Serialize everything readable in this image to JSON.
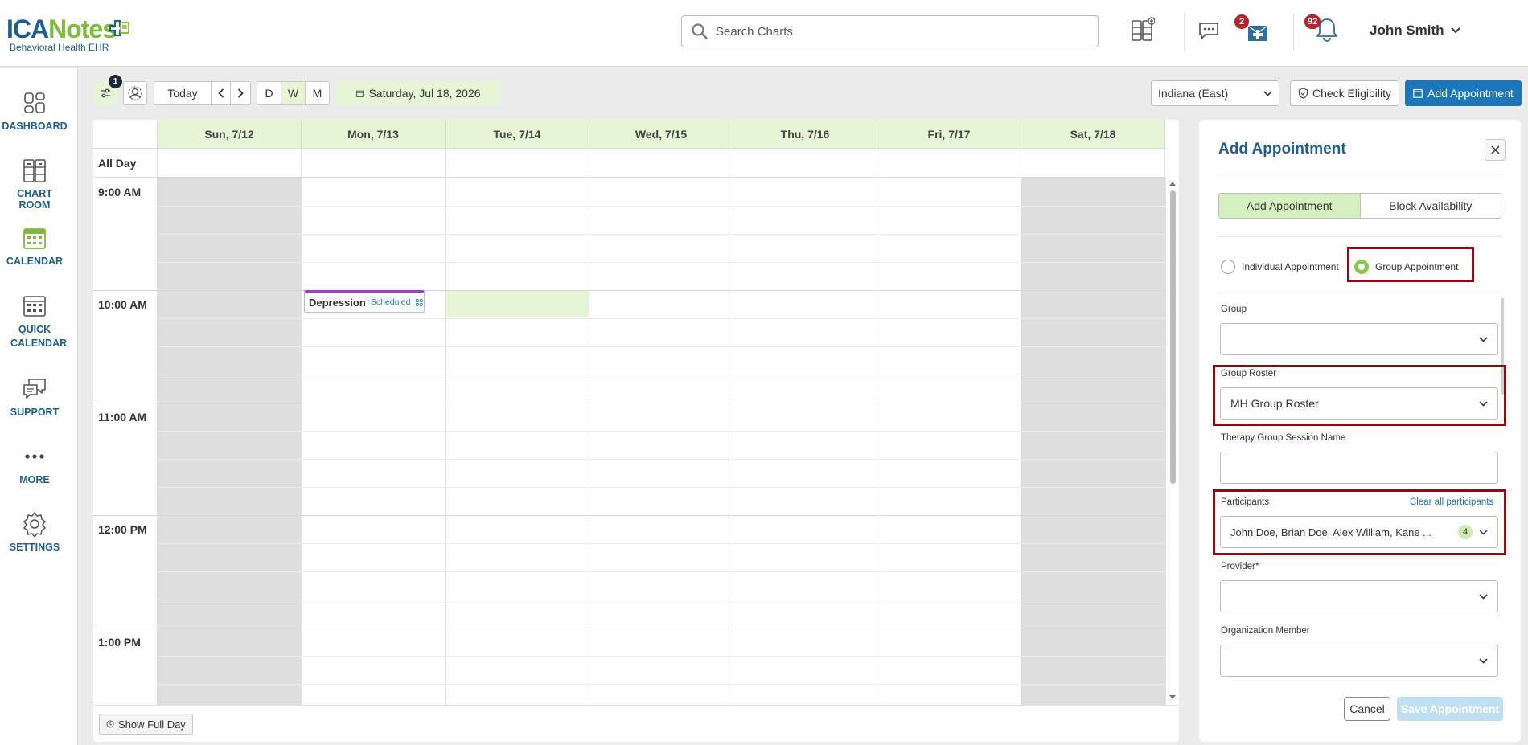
{
  "header": {
    "logo_ica": "ICA",
    "logo_notes": "Notes",
    "logo_subtitle": "Behavioral Health EHR",
    "search_placeholder": "Search Charts",
    "messages_badge": "2",
    "notifications_badge": "92",
    "user_name": "John Smith"
  },
  "sidebar": {
    "items": [
      {
        "label": "DASHBOARD",
        "icon": "dashboard-icon"
      },
      {
        "label": "CHART ROOM",
        "icon": "chart-room-icon"
      },
      {
        "label": "CALENDAR",
        "icon": "calendar-icon"
      },
      {
        "label": "QUICK CALENDAR",
        "icon": "quick-calendar-icon"
      },
      {
        "label": "SUPPORT",
        "icon": "support-icon"
      },
      {
        "label": "MORE",
        "icon": "more-icon"
      },
      {
        "label": "SETTINGS",
        "icon": "settings-icon"
      }
    ]
  },
  "toolbar": {
    "filter_badge": "1",
    "today_label": "Today",
    "views": [
      "D",
      "W",
      "M"
    ],
    "active_view": "W",
    "current_date": "Saturday, Jul 18, 2026",
    "timezone": "Indiana (East)",
    "check_eligibility": "Check Eligibility",
    "add_appointment": "Add Appointment"
  },
  "calendar": {
    "days": [
      "Sun, 7/12",
      "Mon, 7/13",
      "Tue, 7/14",
      "Wed, 7/15",
      "Thu, 7/16",
      "Fri, 7/17",
      "Sat, 7/18"
    ],
    "all_day_label": "All Day",
    "hours": [
      "9:00 AM",
      "10:00 AM",
      "11:00 AM",
      "12:00 PM",
      "1:00 PM"
    ],
    "event": {
      "title": "Depression",
      "status": "Scheduled"
    },
    "show_full_day": "Show Full Day"
  },
  "panel": {
    "title": "Add Appointment",
    "tabs": [
      "Add Appointment",
      "Block Availability"
    ],
    "radio_individual": "Individual Appointment",
    "radio_group": "Group Appointment",
    "group_label": "Group",
    "group_value": "",
    "roster_label": "Group Roster",
    "roster_value": "MH Group Roster",
    "session_label": "Therapy Group Session Name",
    "participants_label": "Participants",
    "clear_participants": "Clear all participants",
    "participants_value": "John Doe, Brian Doe, Alex William, Kane ...",
    "participants_count": "4",
    "provider_label": "Provider*",
    "org_member_label": "Organization Member",
    "cancel": "Cancel",
    "save": "Save Appointment"
  },
  "colors": {
    "brand_blue": "#1d5f8c",
    "brand_green": "#7dbb3a",
    "accent_blue": "#1d76b8",
    "highlight_green": "#e6f5d6",
    "annotation_red": "#8b0d13",
    "event_purple": "#a23ad6"
  }
}
